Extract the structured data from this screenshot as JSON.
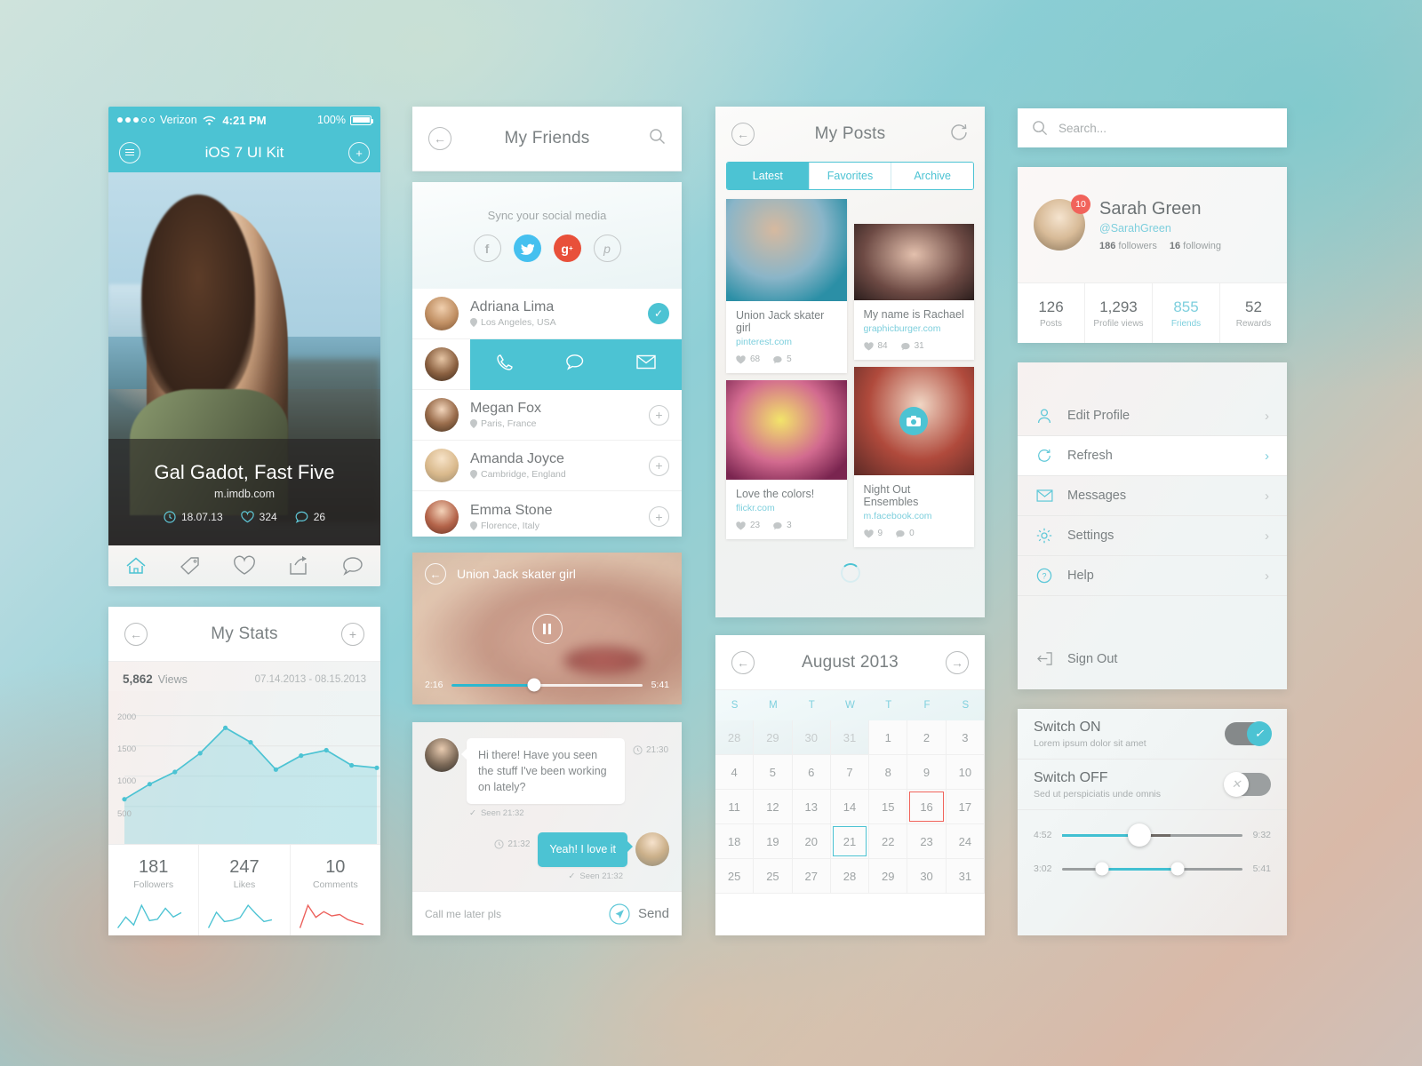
{
  "phone": {
    "status": {
      "carrier": "Verizon",
      "time": "4:21 PM",
      "battery": "100%"
    },
    "nav": {
      "title": "iOS 7 UI Kit",
      "menu_icon": "hamburger-icon",
      "add_icon": "plus-icon"
    },
    "hero": {
      "title": "Gal Gadot, Fast Five",
      "source": "m.imdb.com",
      "date": "18.07.13",
      "likes": "324",
      "comments": "26"
    },
    "tabs": [
      "home-icon",
      "tag-icon",
      "heart-icon",
      "share-icon",
      "comment-icon"
    ]
  },
  "stats": {
    "nav": {
      "title": "My Stats",
      "back_icon": "back-arrow-icon",
      "add_icon": "plus-icon"
    },
    "views_value": "5,862",
    "views_label": "Views",
    "range": "07.14.2013 - 08.15.2013",
    "tiles": [
      {
        "n": "181",
        "l": "Followers",
        "color": "#4cc3d3"
      },
      {
        "n": "247",
        "l": "Likes",
        "color": "#4cc3d3"
      },
      {
        "n": "10",
        "l": "Comments",
        "color": "#ec5f5a"
      }
    ]
  },
  "chart_data": [
    {
      "type": "area",
      "title": "My Stats — Views",
      "xlabel": "",
      "ylabel": "Views",
      "ylim": [
        0,
        2200
      ],
      "yticks": [
        500,
        1000,
        1500,
        2000
      ],
      "grid": true,
      "legend": false,
      "x": [
        1,
        2,
        3,
        4,
        5,
        6,
        7,
        8,
        9,
        10,
        11
      ],
      "values": [
        620,
        870,
        1070,
        1380,
        1800,
        1560,
        1110,
        1340,
        1430,
        1180,
        1140
      ],
      "line_color": "#4cc3d3",
      "fill_color": "rgba(76,195,211,0.25)"
    },
    {
      "type": "line",
      "title": "Followers sparkline",
      "values": [
        10,
        40,
        18,
        72,
        30,
        34,
        64,
        40,
        52
      ],
      "line_color": "#4cc3d3",
      "grid": false,
      "legend": false
    },
    {
      "type": "line",
      "title": "Likes sparkline",
      "values": [
        8,
        62,
        30,
        34,
        44,
        86,
        56,
        30,
        36
      ],
      "line_color": "#4cc3d3",
      "grid": false,
      "legend": false
    },
    {
      "type": "line",
      "title": "Comments sparkline",
      "values": [
        10,
        74,
        40,
        56,
        44,
        48,
        34,
        26,
        20
      ],
      "line_color": "#ec5f5a",
      "grid": false,
      "legend": false
    }
  ],
  "friends": {
    "nav": {
      "title": "My Friends",
      "back_icon": "back-arrow-icon",
      "search_icon": "search-icon"
    },
    "sync_label": "Sync your social media",
    "socials": [
      "facebook-icon",
      "twitter-icon",
      "google-plus-icon",
      "pinterest-icon"
    ],
    "items": [
      {
        "name": "Adriana Lima",
        "loc": "Los Angeles, USA",
        "state": "added"
      },
      {
        "name": "",
        "loc": "",
        "state": "actions"
      },
      {
        "name": "Megan Fox",
        "loc": "Paris, France",
        "state": "add"
      },
      {
        "name": "Amanda Joyce",
        "loc": "Cambridge, England",
        "state": "add"
      },
      {
        "name": "Emma Stone",
        "loc": "Florence, Italy",
        "state": "add"
      }
    ],
    "action_icons": [
      "phone-icon",
      "chat-icon",
      "mail-icon"
    ]
  },
  "video": {
    "title": "Union Jack skater girl",
    "back_icon": "back-arrow-icon",
    "play_state": "pause-icon",
    "elapsed": "2:16",
    "duration": "5:41"
  },
  "chat": {
    "incoming": {
      "text": "Hi there! Have you seen the stuff I've been working on lately?",
      "time": "21:30",
      "seen": "Seen 21:32"
    },
    "outgoing": {
      "text": "Yeah! I love it",
      "time": "21:32",
      "seen": "Seen 21:32"
    },
    "input_value": "Call me later pls",
    "send_label": "Send",
    "send_icon": "send-icon"
  },
  "posts": {
    "nav": {
      "title": "My Posts",
      "back_icon": "back-arrow-icon",
      "refresh_icon": "refresh-icon"
    },
    "tabs": [
      {
        "label": "Latest",
        "active": true
      },
      {
        "label": "Favorites",
        "active": false
      },
      {
        "label": "Archive",
        "active": false
      }
    ],
    "left": [
      {
        "title": "Union Jack skater girl",
        "url": "pinterest.com",
        "likes": "68",
        "comments": "5"
      },
      {
        "title": "Love the colors!",
        "url": "flickr.com",
        "likes": "23",
        "comments": "3"
      }
    ],
    "right": [
      {
        "title": "My name is Rachael",
        "url": "graphicburger.com",
        "likes": "84",
        "comments": "31"
      },
      {
        "title": "Night Out Ensembles",
        "url": "m.facebook.com",
        "likes": "9",
        "comments": "0",
        "overlay_icon": "camera-icon"
      }
    ],
    "loader_icon": "spinner-icon"
  },
  "calendar": {
    "month": "August 2013",
    "prev_icon": "back-arrow-icon",
    "next_icon": "forward-arrow-icon",
    "weekdays": [
      "S",
      "M",
      "T",
      "W",
      "T",
      "F",
      "S"
    ],
    "days": [
      {
        "d": "28",
        "mute": true
      },
      {
        "d": "29",
        "mute": true
      },
      {
        "d": "30",
        "mute": true
      },
      {
        "d": "31",
        "mute": true
      },
      {
        "d": "1"
      },
      {
        "d": "2"
      },
      {
        "d": "3"
      },
      {
        "d": "4"
      },
      {
        "d": "5"
      },
      {
        "d": "6"
      },
      {
        "d": "7"
      },
      {
        "d": "8"
      },
      {
        "d": "9"
      },
      {
        "d": "10"
      },
      {
        "d": "11"
      },
      {
        "d": "12"
      },
      {
        "d": "13"
      },
      {
        "d": "14"
      },
      {
        "d": "15"
      },
      {
        "d": "16",
        "alert": true
      },
      {
        "d": "17"
      },
      {
        "d": "18"
      },
      {
        "d": "19"
      },
      {
        "d": "20"
      },
      {
        "d": "21",
        "today": true
      },
      {
        "d": "22"
      },
      {
        "d": "23"
      },
      {
        "d": "24"
      },
      {
        "d": "25"
      },
      {
        "d": "25"
      },
      {
        "d": "27"
      },
      {
        "d": "28"
      },
      {
        "d": "29"
      },
      {
        "d": "30"
      },
      {
        "d": "31"
      }
    ]
  },
  "search": {
    "placeholder": "Search...",
    "icon": "search-icon"
  },
  "profile": {
    "badge": "10",
    "name": "Sarah Green",
    "handle": "@SarahGreen",
    "followers_n": "186",
    "followers_l": "followers",
    "following_n": "16",
    "following_l": "following",
    "stats": [
      {
        "n": "126",
        "l": "Posts",
        "hl": false
      },
      {
        "n": "1,293",
        "l": "Profile views",
        "hl": false
      },
      {
        "n": "855",
        "l": "Friends",
        "hl": true
      },
      {
        "n": "52",
        "l": "Rewards",
        "hl": false
      }
    ]
  },
  "menu": {
    "items": [
      {
        "label": "Edit Profile",
        "icon": "user-icon",
        "white": false
      },
      {
        "label": "Refresh",
        "icon": "refresh-icon",
        "white": true
      },
      {
        "label": "Messages",
        "icon": "mail-icon",
        "white": false
      },
      {
        "label": "Settings",
        "icon": "gear-icon",
        "white": false
      },
      {
        "label": "Help",
        "icon": "question-icon",
        "white": false
      }
    ],
    "signout": {
      "label": "Sign Out",
      "icon": "signout-icon"
    }
  },
  "switches": {
    "on": {
      "title": "Switch ON",
      "desc": "Lorem ipsum dolor sit amet",
      "state": "on",
      "knob_icon": "check-icon"
    },
    "off": {
      "title": "Switch OFF",
      "desc": "Sed ut perspiciatis unde omnis",
      "state": "off",
      "knob_icon": "close-icon"
    },
    "slider1": {
      "left": "4:52",
      "right": "9:32",
      "value_pct": 43
    },
    "slider2": {
      "left": "3:02",
      "right": "5:41",
      "low_pct": 22,
      "high_pct": 64
    }
  },
  "colors": {
    "accent": "#4cc3d3",
    "danger": "#f1635b",
    "twitter": "#45c0ef",
    "google": "#e8503a"
  }
}
